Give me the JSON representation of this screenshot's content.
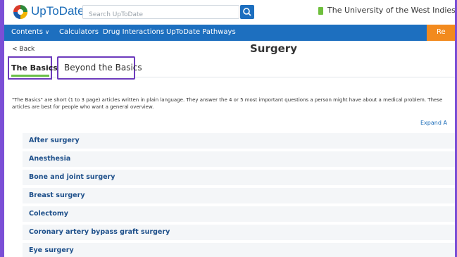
{
  "header": {
    "logo_text": "UpToDate",
    "logo_mark": "®",
    "search_placeholder": "Search UpToDate",
    "institution": "The University of the West Indies - Trinida"
  },
  "nav": {
    "items": [
      "Contents",
      "Calculators",
      "Drug Interactions",
      "UpToDate Pathways"
    ],
    "contents_arrow": "∨",
    "right_button": "Re"
  },
  "page": {
    "back_label": "< Back",
    "title": "Surgery",
    "tabs": [
      {
        "label": "The Basics",
        "active": true
      },
      {
        "label": "Beyond the Basics",
        "active": false
      }
    ],
    "intro": "\"The Basics\" are short (1 to 3 page) articles written in plain language. They answer the 4 or 5 most important questions a person might have about a medical problem. These articles are best for people who want a general overview.",
    "expand_label": "Expand A",
    "topics": [
      "After surgery",
      "Anesthesia",
      "Bone and joint surgery",
      "Breast surgery",
      "Colectomy",
      "Coronary artery bypass graft surgery",
      "Eye surgery"
    ]
  },
  "colors": {
    "nav_blue": "#1d6fbf",
    "accent_orange": "#f28a1e",
    "tab_underline": "#6cc04a",
    "highlight_purple": "#6d3bbd",
    "topic_text": "#1d4f8a"
  }
}
